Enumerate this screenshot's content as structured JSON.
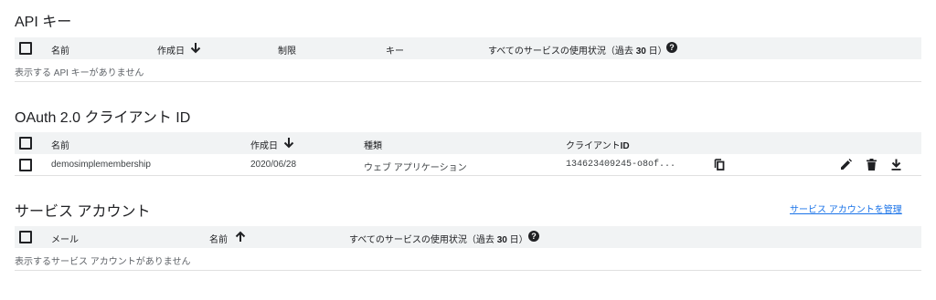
{
  "api_keys": {
    "title": "API キー",
    "columns": {
      "name": "名前",
      "created": "作成日",
      "restrictions": "制限",
      "key": "キー",
      "usage": "すべてのサービスの使用状況（過去",
      "usage_days": "30",
      "usage_suffix": "日）"
    },
    "empty_message": "表示する API キーがありません"
  },
  "oauth": {
    "title": "OAuth 2.0 クライアント ID",
    "columns": {
      "name": "名前",
      "created": "作成日",
      "type": "種類",
      "client_id": "クライアント",
      "client_id_suffix": "ID"
    },
    "rows": [
      {
        "name": "demosimplemembership",
        "created": "2020/06/28",
        "type": "ウェブ アプリケーション",
        "client_id": "134623409245-o8of..."
      }
    ]
  },
  "service_accounts": {
    "title": "サービス アカウント",
    "manage_link": "サービス アカウントを管理",
    "columns": {
      "email": "メール",
      "name": "名前",
      "usage": "すべてのサービスの使用状況（過去",
      "usage_days": "30",
      "usage_suffix": "日）"
    },
    "empty_message": "表示するサービス アカウントがありません"
  },
  "icons": {
    "sort_desc": "arrow-down-icon",
    "sort_asc": "arrow-up-icon",
    "help": "help-icon",
    "copy": "copy-icon",
    "edit": "pencil-icon",
    "delete": "trash-icon",
    "download": "download-icon"
  },
  "colors": {
    "header_bg": "#f1f3f4",
    "link": "#1a73e8",
    "text": "#202124"
  }
}
